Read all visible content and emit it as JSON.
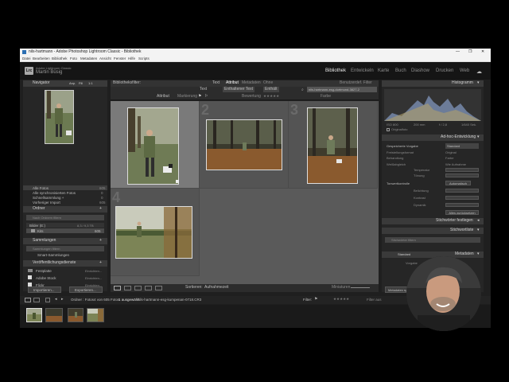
{
  "window": {
    "title": "nils-hartmann - Adobe Photoshop Lightroom Classic - Bibliothek",
    "controls": [
      "—",
      "❐",
      "✕"
    ]
  },
  "menu": [
    "Datei",
    "Bearbeiten",
    "Bibliothek",
    "Foto",
    "Metadaten",
    "Ansicht",
    "Fenster",
    "Hilfe",
    "Scripts"
  ],
  "identity": {
    "app_line": "Adobe Lightroom Classic",
    "user": "Martin Büsig",
    "logo": "Lrc"
  },
  "modules": {
    "items": [
      "Bibliothek",
      "Entwickeln",
      "Karte",
      "Buch",
      "Diashow",
      "Drucken",
      "Web"
    ],
    "active": "Bibliothek"
  },
  "navigator": {
    "title": "Navigator",
    "options": [
      "Anp.",
      "Fill",
      "1:1"
    ]
  },
  "catalog": {
    "items": [
      {
        "label": "Alle Fotos",
        "count": "605"
      },
      {
        "label": "Alle synchronisierten Fotos",
        "count": "0"
      },
      {
        "label": "Schnellsammlung +",
        "count": "0"
      },
      {
        "label": "Vorheriger Import",
        "count": "605"
      }
    ]
  },
  "folders": {
    "title": "Ordner",
    "filter": "Nach Ordnern filtern",
    "volume": "Bilder (E:)",
    "volume_info": "8,3 / 9,3 TB",
    "folder": "Kits",
    "folder_count": "605"
  },
  "collections": {
    "title": "Sammlungen",
    "filter": "Sammlungen filtern",
    "item": "Smart-Sammlungen"
  },
  "publish": {
    "title": "Veröffentlichungsdienste",
    "items": [
      {
        "label": "Festplatte",
        "action": "Einrichten..."
      },
      {
        "label": "Adobe Stock",
        "action": "Einrichten..."
      },
      {
        "label": "Flickr",
        "action": "Einrichten..."
      }
    ]
  },
  "left_buttons": {
    "import": "Importieren...",
    "export": "Exportieren..."
  },
  "filter_bar": {
    "label": "Bibliotheksfilter:",
    "tabs": [
      "Text",
      "Attribut",
      "Metadaten",
      "Ohne"
    ],
    "active_tab": "Attribut",
    "preset": "Benutzerdef. Filter",
    "text_label": "Text",
    "text_field": "Enthaltener Text",
    "text_rule": "Enthält",
    "search_value": "nils-hartmann-esg-dortmund-3827-2",
    "attribute_label": "Attribut",
    "flag_label": "Markierung",
    "rating_label": "Bewertung",
    "color_label": "Farbe",
    "swatch_colors": [
      "#c94d4d",
      "#d4c24a",
      "#5aa65a",
      "#4a7fc9",
      "#9a5ac9"
    ]
  },
  "grid": {
    "cells": [
      {
        "number": "",
        "selected": true
      },
      {
        "number": "2",
        "selected": false
      },
      {
        "number": "3",
        "selected": false
      },
      {
        "number": "4",
        "selected": false
      }
    ]
  },
  "toolbar": {
    "sort_label": "Sortieren:",
    "sort_value": "Aufnahmezeit",
    "thumbs_label": "Miniaturen"
  },
  "histogram": {
    "title": "Histogramm",
    "iso": "ISO 800",
    "focal": "200 mm",
    "aperture": "f / 2,8",
    "shutter": "1/640 Sek.",
    "original": "Originalfoto"
  },
  "quick_develop": {
    "title": "Ad-hoc-Entwicklung",
    "saved_preset_label": "Gespeicherte Vorgabe",
    "saved_preset_value": "Standard",
    "crop_label": "Freistellungsformat",
    "crop_value": "Original",
    "treatment_label": "Behandlung",
    "treatment_value": "Farbe",
    "wb_label": "Weißabgleich",
    "wb_value": "Wie Aufnahme",
    "temp_label": "Temperatur",
    "tint_label": "Tönung",
    "tone_label": "Tonwertkontrolle",
    "tone_auto": "Automatisch",
    "exposure_label": "Belichtung",
    "contrast_label": "Kontrast",
    "vibrance_label": "Dynamik",
    "reset_button": "Alles zurücksetzen"
  },
  "keywording": {
    "title": "Stichwörter festlegen"
  },
  "keyword_list": {
    "title": "Stichwortliste",
    "filter": "Stichwörter filtern"
  },
  "metadata": {
    "title": "Metadaten",
    "preset_label": "Standard",
    "field_label": "Vorgabe",
    "field_value": "Ohne"
  },
  "sync": {
    "metadata": "Metadaten synchr.",
    "settings": "Einst. synchr."
  },
  "filmstrip": {
    "source": "Ordner : Fotos",
    "count": "4 von 605 Fotos",
    "selected_label": "1 ausgewählt",
    "filename": "nils-hartmann-esg-kumpenan-0718.CR3",
    "filter_label": "Filter:",
    "filter_state": "Filter aus"
  }
}
